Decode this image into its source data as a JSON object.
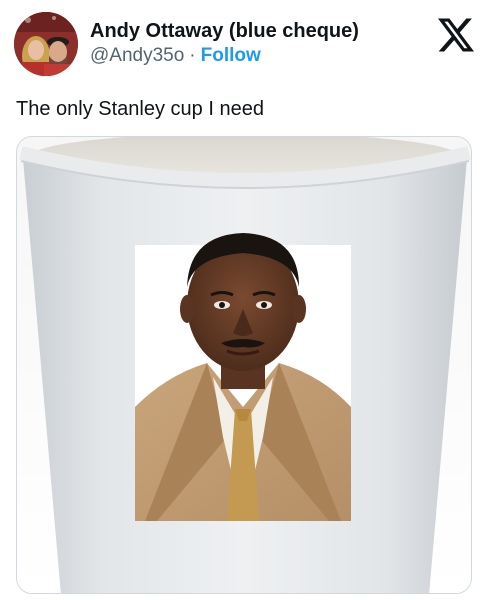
{
  "author": {
    "display_name": "Andy Ottaway (blue cheque)",
    "handle": "@Andy35o",
    "separator": "·",
    "follow_label": "Follow",
    "avatar_icon": "avatar-photo-icon"
  },
  "brand": {
    "logo_icon": "x-logo-icon"
  },
  "tweet": {
    "text": "The only Stanley cup I need"
  },
  "media": {
    "description_icon": "paper-cup-with-face-photo"
  },
  "colors": {
    "link": "#1d9bf0",
    "secondary_text": "#536471",
    "primary_text": "#0f1419",
    "border": "#cfd9de"
  }
}
